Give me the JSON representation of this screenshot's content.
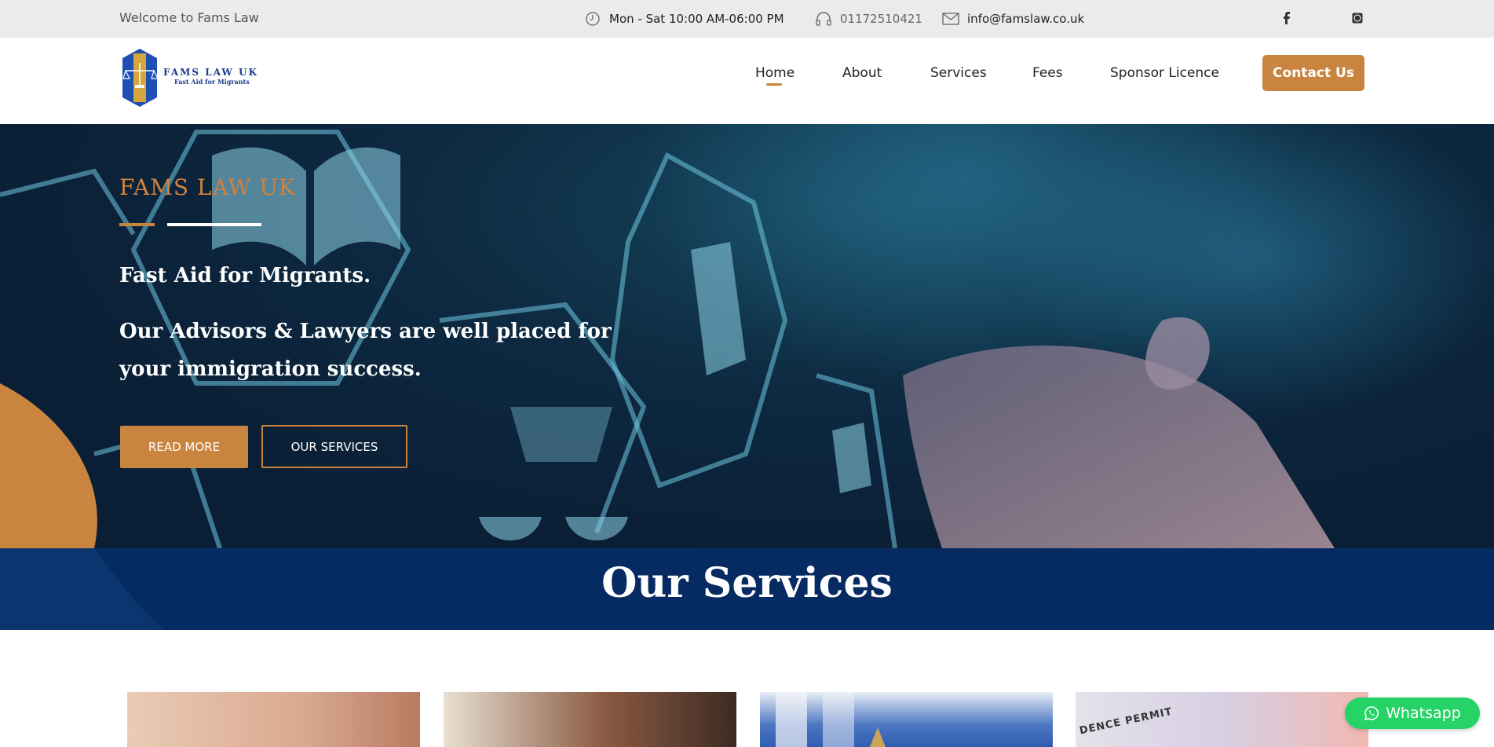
{
  "topbar": {
    "welcome": "Welcome to Fams Law",
    "hours": "Mon - Sat 10:00 AM-06:00 PM",
    "phone": "01172510421",
    "email": "info@famslaw.co.uk",
    "social_icons": [
      "facebook-icon",
      "whatsapp-icon"
    ]
  },
  "header": {
    "logo_title": "FAMS LAW UK",
    "logo_subtitle": "Fast Aid for Migrants",
    "nav": [
      {
        "label": "Home",
        "active": true
      },
      {
        "label": "About"
      },
      {
        "label": "Services"
      },
      {
        "label": "Fees"
      },
      {
        "label": "Sponsor Licence"
      }
    ],
    "contact_label": "Contact Us"
  },
  "hero": {
    "brand": "FAMS LAW UK",
    "line1": "Fast Aid for Migrants.",
    "line2": "Our Advisors & Lawyers are well placed for your immigration success.",
    "read_more": "READ MORE",
    "our_services": "OUR SERVICES"
  },
  "services": {
    "title": "Our Services",
    "card4_partial_text": "DENCE PERMIT"
  },
  "whatsapp": {
    "label": "Whatsapp"
  },
  "colors": {
    "accent": "#c98440",
    "navy": "#062a62",
    "whatsapp": "#25d366",
    "topbar_bg": "#ebebeb"
  }
}
